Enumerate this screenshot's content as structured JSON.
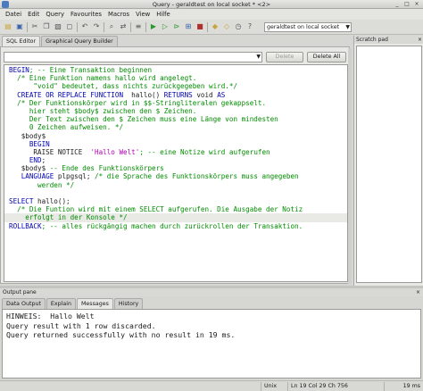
{
  "window": {
    "title": "Query - geraldtest on local socket * <2>"
  },
  "menu": [
    "Datei",
    "Edit",
    "Query",
    "Favourites",
    "Macros",
    "View",
    "Hilfe"
  ],
  "toolbar": {
    "connection": "geraldtest on local socket"
  },
  "editor_tabs": [
    "SQL Editor",
    "Graphical Query Builder"
  ],
  "filter": {
    "delete_label": "Delete",
    "delete_all_label": "Delete All"
  },
  "code_lines": [
    [
      {
        "t": "BEGIN",
        "c": "kw"
      },
      {
        "t": "; -- Eine Transaktion beginnen",
        "c": "cm"
      }
    ],
    [
      {
        "t": "  /* Eine Funktion namens hallo wird angelegt.",
        "c": "cm"
      }
    ],
    [
      {
        "t": "      \"void\" bedeutet, dass nichts zurückgegeben wird.*/",
        "c": "cm"
      }
    ],
    [
      {
        "t": "  CREATE OR REPLACE FUNCTION",
        "c": "kw"
      },
      {
        "t": "  hallo() ",
        "c": "pl"
      },
      {
        "t": "RETURNS",
        "c": "kw"
      },
      {
        "t": " void ",
        "c": "pl"
      },
      {
        "t": "AS",
        "c": "kw"
      }
    ],
    [
      {
        "t": "  /* Der Funktionskörper wird in $$-Stringliteralen gekappselt.",
        "c": "cm"
      }
    ],
    [
      {
        "t": "     hier steht $body$ zwischen den $ Zeichen.",
        "c": "cm"
      }
    ],
    [
      {
        "t": "     Der Text zwischen den $ Zeichen muss eine Länge von mindesten",
        "c": "cm"
      }
    ],
    [
      {
        "t": "     0 Zeichen aufweisen. */",
        "c": "cm"
      }
    ],
    [
      {
        "t": "   $body$",
        "c": "pl"
      }
    ],
    [
      {
        "t": "     BEGIN",
        "c": "kw"
      }
    ],
    [
      {
        "t": "      RAISE NOTICE  ",
        "c": "pl"
      },
      {
        "t": "'Hallo Welt'",
        "c": "st"
      },
      {
        "t": "; -- eine Notize wird aufgerufen",
        "c": "cm"
      }
    ],
    [
      {
        "t": "     END",
        "c": "kw"
      },
      {
        "t": ";",
        "c": "pl"
      }
    ],
    [
      {
        "t": "   $body$ ",
        "c": "pl"
      },
      {
        "t": "-- Ende des Funktionskörpers",
        "c": "cm"
      }
    ],
    [
      {
        "t": "   LANGUAGE",
        "c": "kw"
      },
      {
        "t": " plpgsql; ",
        "c": "pl"
      },
      {
        "t": "/* die Sprache des Funktionskörpers muss angegeben",
        "c": "cm"
      }
    ],
    [
      {
        "t": "       werden */",
        "c": "cm"
      }
    ],
    [],
    [
      {
        "t": "SELECT",
        "c": "kw"
      },
      {
        "t": " hallo();",
        "c": "pl"
      }
    ],
    [
      {
        "t": "  /* Die Funtion wird mit einem SELECT aufgerufen. Die Ausgabe der Notiz",
        "c": "cm"
      }
    ],
    [
      {
        "t": "    erfolgt in der Konsole */",
        "c": "cm"
      }
    ],
    [
      {
        "t": "ROLLBACK",
        "c": "kw"
      },
      {
        "t": "; -- alles rückgängig machen durch zurückrollen der Transaktion.",
        "c": "cm"
      }
    ]
  ],
  "scratch": {
    "title": "Scratch pad"
  },
  "output": {
    "title": "Output pane",
    "tabs": [
      "Data Output",
      "Explain",
      "Messages",
      "History"
    ],
    "lines": [
      "HINWEIS:  Hallo Welt",
      "Query result with 1 row discarded.",
      "",
      "Query returned successfully with no result in 19 ms."
    ]
  },
  "status": {
    "mode": "Unix",
    "position": "Ln 19 Col 29 Ch 756",
    "time": "19 ms"
  },
  "colors": {
    "keyword": "#0000b4",
    "comment": "#008c00",
    "string": "#b000b0"
  }
}
